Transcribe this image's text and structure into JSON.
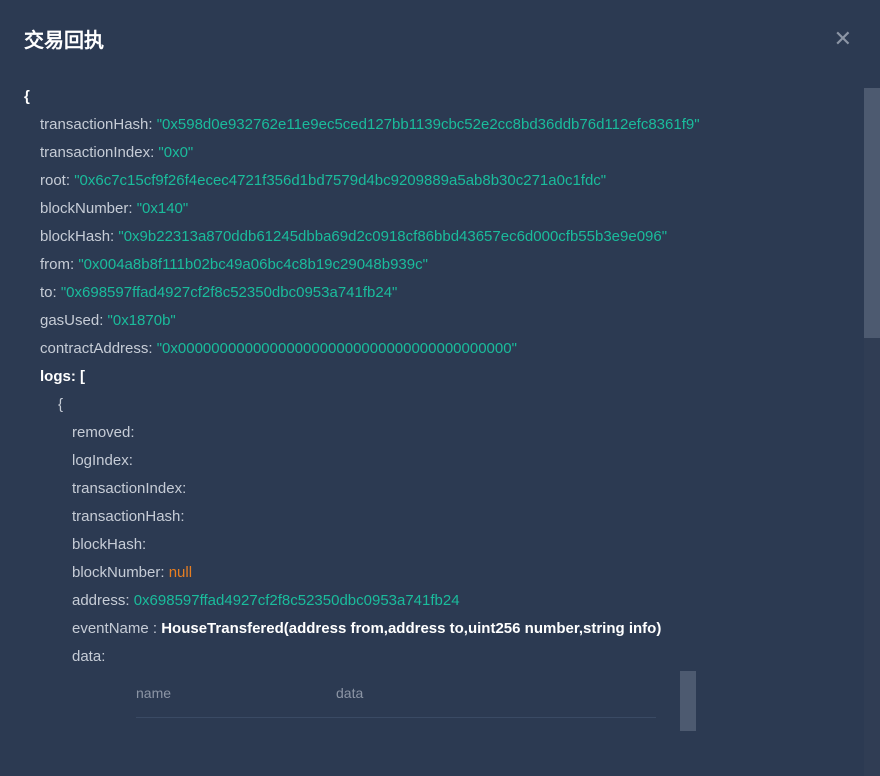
{
  "dialog": {
    "title": "交易回执"
  },
  "receipt": {
    "transactionHash": {
      "key": "transactionHash: ",
      "value": "\"0x598d0e932762e11e9ec5ced127bb1139cbc52e2cc8bd36ddb76d112efc8361f9\""
    },
    "transactionIndex": {
      "key": "transactionIndex: ",
      "value": "\"0x0\""
    },
    "root": {
      "key": "root: ",
      "value": "\"0x6c7c15cf9f26f4ecec4721f356d1bd7579d4bc9209889a5ab8b30c271a0c1fdc\""
    },
    "blockNumber": {
      "key": "blockNumber: ",
      "value": "\"0x140\""
    },
    "blockHash": {
      "key": "blockHash: ",
      "value": "\"0x9b22313a870ddb61245dbba69d2c0918cf86bbd43657ec6d000cfb55b3e9e096\""
    },
    "from": {
      "key": "from: ",
      "value": "\"0x004a8b8f111b02bc49a06bc4c8b19c29048b939c\""
    },
    "to": {
      "key": "to: ",
      "value": "\"0x698597ffad4927cf2f8c52350dbc0953a741fb24\""
    },
    "gasUsed": {
      "key": "gasUsed: ",
      "value": "\"0x1870b\""
    },
    "contractAddress": {
      "key": "contractAddress: ",
      "value": "\"0x0000000000000000000000000000000000000000\""
    }
  },
  "logs": {
    "label": "logs: [",
    "openBrace": "{",
    "items": {
      "removed": {
        "key": "removed: ",
        "value": ""
      },
      "logIndex": {
        "key": "logIndex: ",
        "value": ""
      },
      "transactionIndex": {
        "key": "transactionIndex: ",
        "value": ""
      },
      "transactionHash": {
        "key": "transactionHash: ",
        "value": ""
      },
      "blockHash": {
        "key": "blockHash: ",
        "value": ""
      },
      "blockNumber": {
        "key": "blockNumber: ",
        "value": "null"
      },
      "address": {
        "key": "address: ",
        "value": "0x698597ffad4927cf2f8c52350dbc0953a741fb24"
      },
      "eventName": {
        "key": "eventName : ",
        "value": "HouseTransfered(address from,address to,uint256 number,string info)"
      },
      "data": {
        "key": "data: ",
        "value": ""
      }
    }
  },
  "dataTable": {
    "columns": {
      "name": "name",
      "data": "data"
    }
  },
  "braces": {
    "open": "{"
  }
}
